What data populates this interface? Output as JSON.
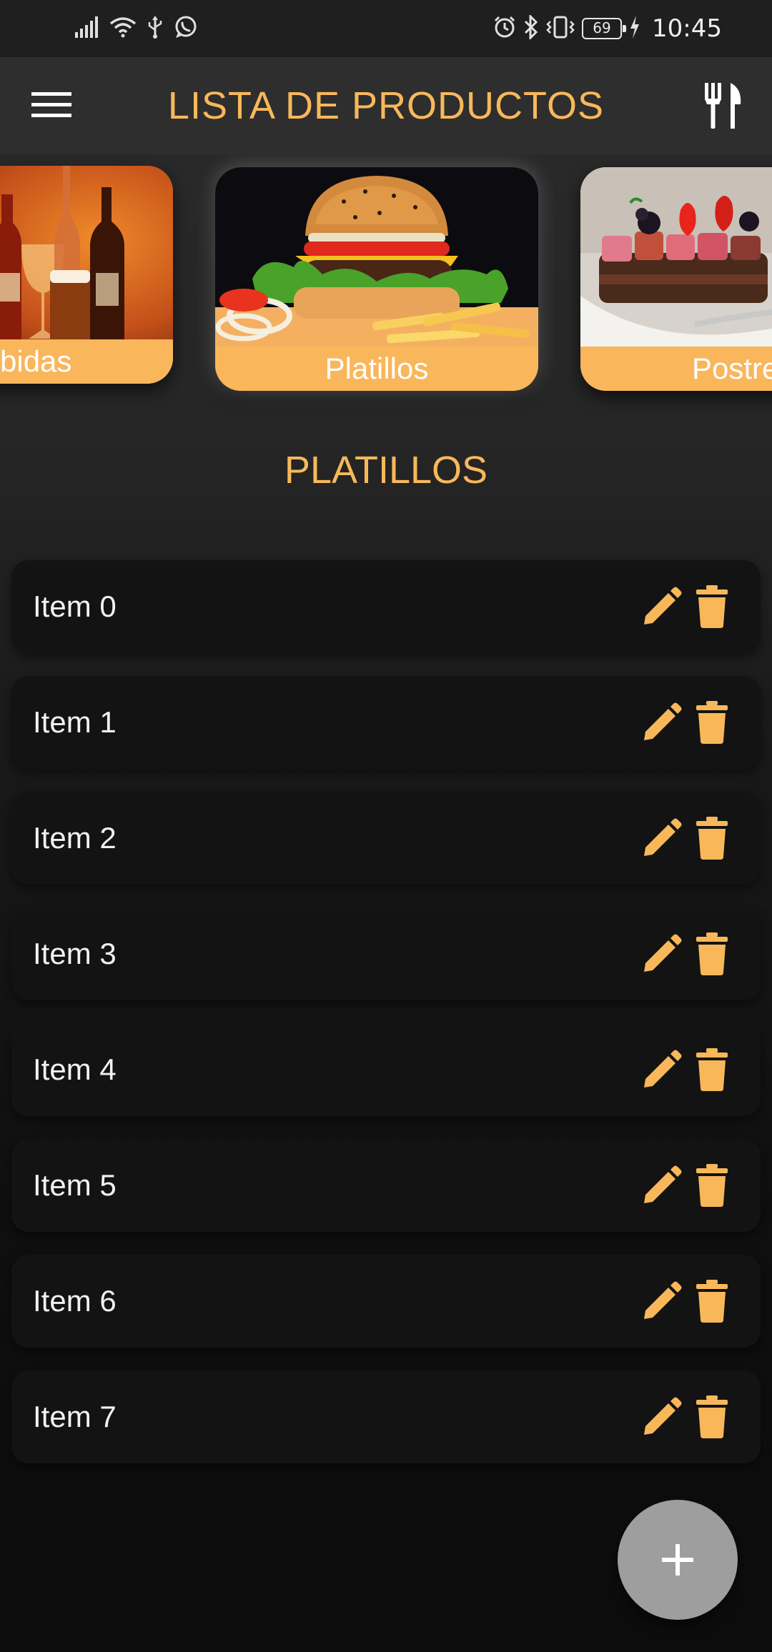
{
  "status_bar": {
    "time": "10:45",
    "battery": "69",
    "left_icons": [
      "signal-icon",
      "wifi-icon",
      "usb-icon",
      "whatsapp-icon"
    ],
    "right_icons": [
      "alarm-icon",
      "bluetooth-icon",
      "vibrate-icon",
      "battery-icon",
      "charging-icon"
    ]
  },
  "appbar": {
    "title": "LISTA DE PRODUCTOS",
    "left_icon": "menu-icon",
    "right_icon": "cutlery-icon"
  },
  "categories": [
    {
      "label": "bidas",
      "selected": false
    },
    {
      "label": "Platillos",
      "selected": true
    },
    {
      "label": "Postre",
      "selected": false
    }
  ],
  "section_title": "PLATILLOS",
  "items": [
    {
      "label": "Item 0"
    },
    {
      "label": "Item 1"
    },
    {
      "label": "Item 2"
    },
    {
      "label": "Item 3"
    },
    {
      "label": "Item 4"
    },
    {
      "label": "Item 5"
    },
    {
      "label": "Item 6"
    },
    {
      "label": "Item 7"
    }
  ],
  "fab": {
    "icon": "plus-icon"
  },
  "colors": {
    "accent": "#f8b85a",
    "card_label_bg": "#f9b65b",
    "background": "#262626",
    "row_bg": "#131313",
    "fab_bg": "#9e9e9e"
  }
}
